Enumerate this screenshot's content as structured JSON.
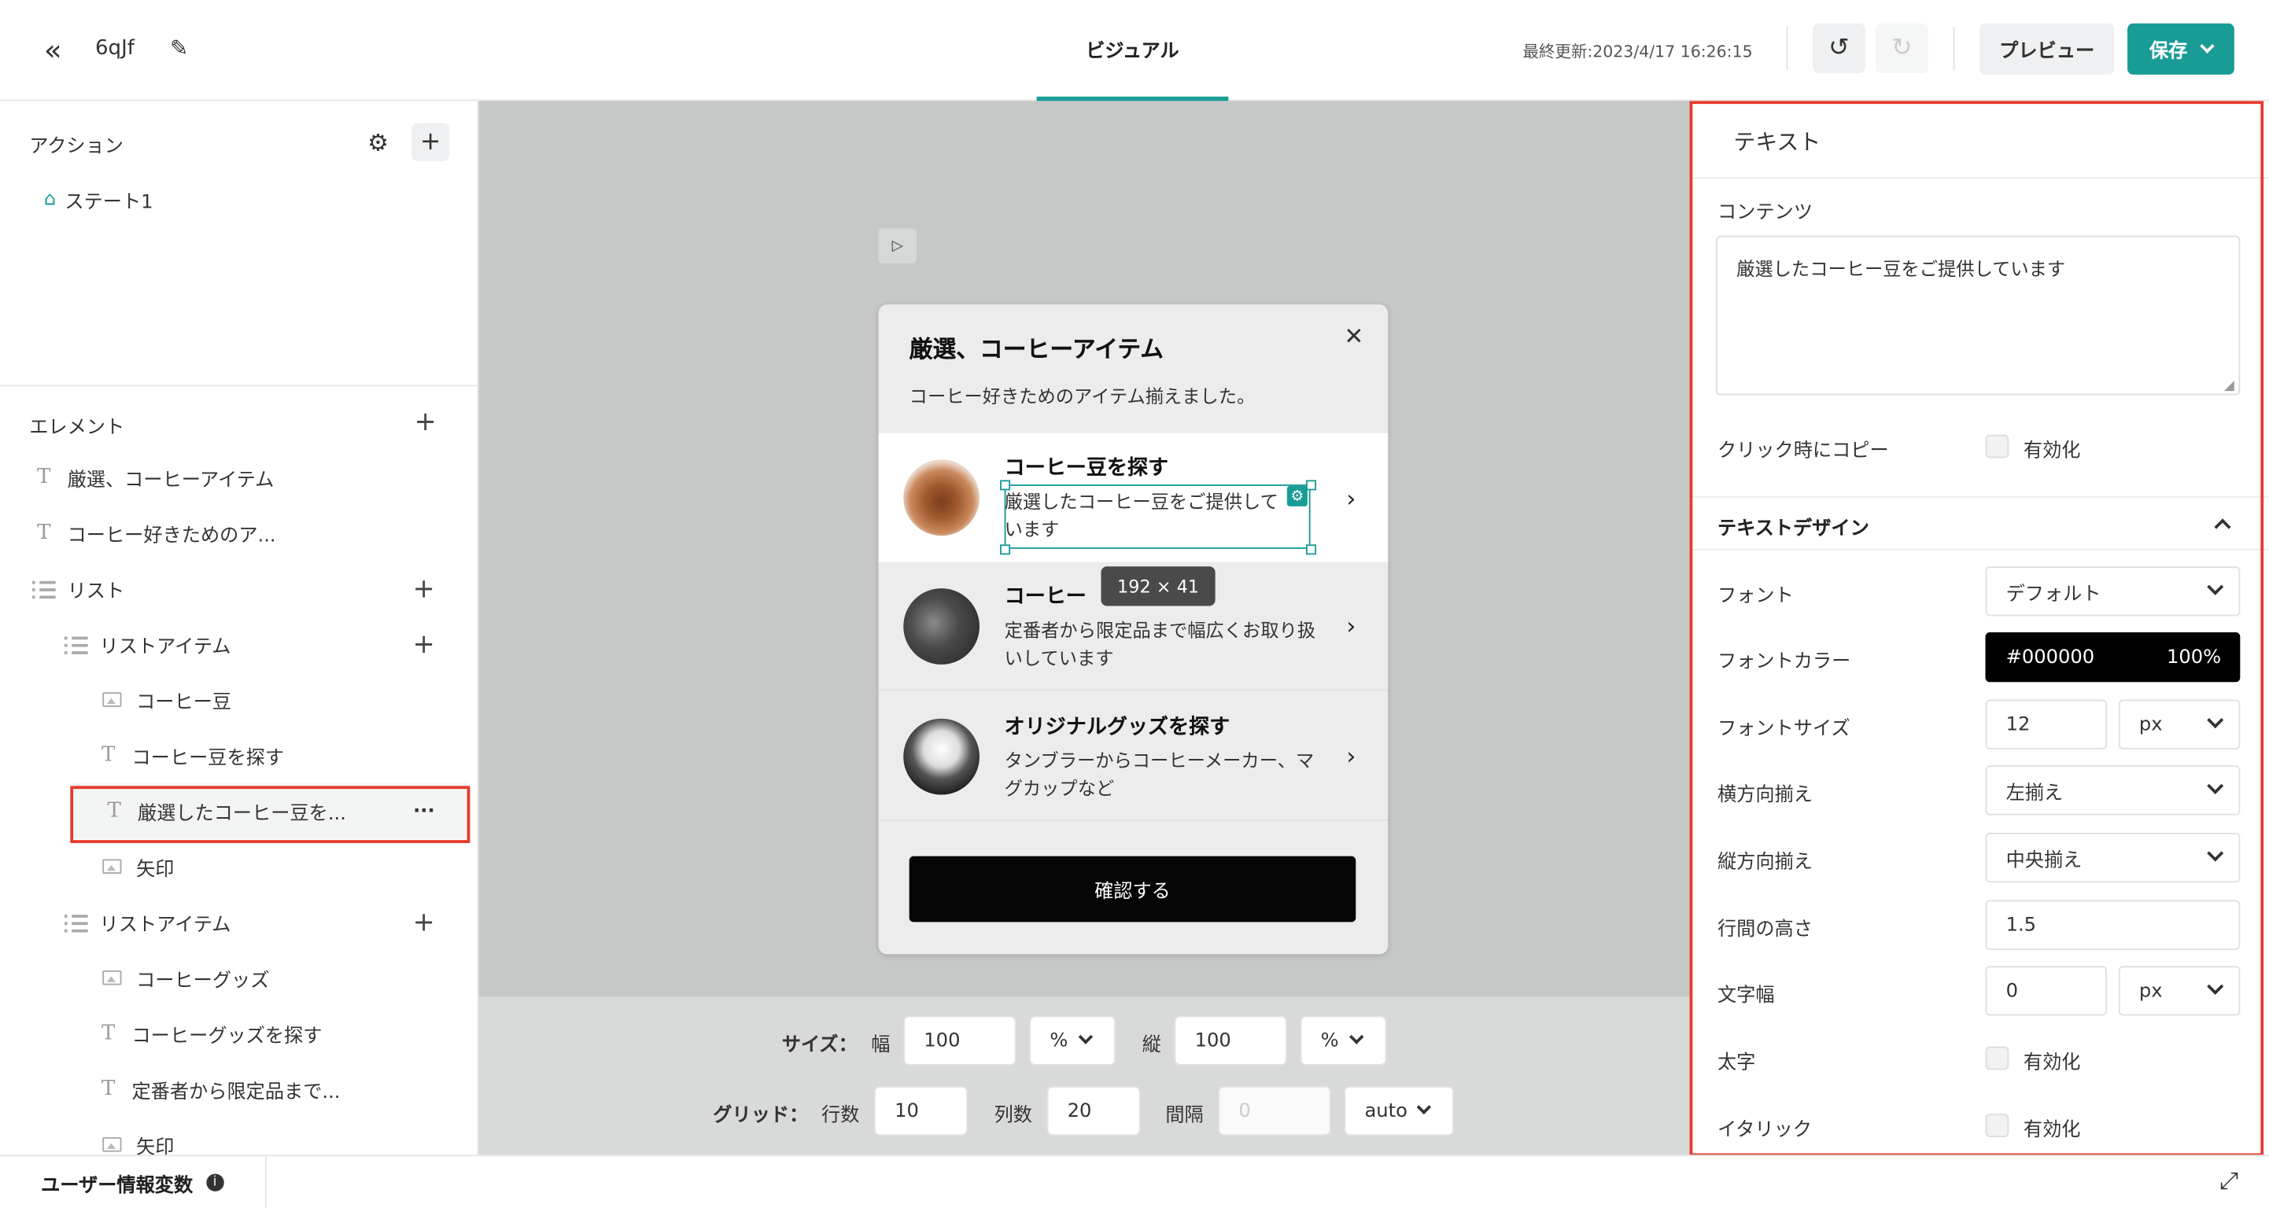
{
  "header": {
    "project_name": "6qJf",
    "center_tab": "ビジュアル",
    "last_updated": "最終更新:2023/4/17 16:26:15",
    "preview_label": "プレビュー",
    "save_label": "保存"
  },
  "sidebar": {
    "actions_title": "アクション",
    "state_label": "ステート1",
    "elements_title": "エレメント",
    "elements": [
      {
        "label": "厳選、コーヒーアイテム",
        "kind": "text"
      },
      {
        "label": "コーヒー好きためのア...",
        "kind": "text"
      },
      {
        "label": "リスト",
        "kind": "list"
      },
      {
        "label": "リストアイテム",
        "kind": "list"
      },
      {
        "label": "コーヒー豆",
        "kind": "image"
      },
      {
        "label": "コーヒー豆を探す",
        "kind": "text"
      },
      {
        "label": "厳選したコーヒー豆を...",
        "kind": "text",
        "selected": true
      },
      {
        "label": "矢印",
        "kind": "image"
      },
      {
        "label": "リストアイテム",
        "kind": "list"
      },
      {
        "label": "コーヒーグッズ",
        "kind": "image"
      },
      {
        "label": "コーヒーグッズを探す",
        "kind": "text"
      },
      {
        "label": "定番者から限定品まで...",
        "kind": "text"
      },
      {
        "label": "矢印",
        "kind": "image"
      }
    ]
  },
  "modal": {
    "title": "厳選、コーヒーアイテム",
    "subtitle": "コーヒー好きためのアイテム揃えました。",
    "items": [
      {
        "title": "コーヒー豆を探す",
        "desc": "厳選したコーヒー豆をご提供しています"
      },
      {
        "title": "コーヒー",
        "desc": "定番者から限定品まで幅広くお取り扱いしています"
      },
      {
        "title": "オリジナルグッズを探す",
        "desc": "タンブラーからコーヒーメーカー、マグカップなど"
      }
    ],
    "confirm_label": "確認する",
    "size_tooltip": "192 × 41"
  },
  "canvas_controls": {
    "size_label": "サイズ：",
    "width_label": "幅",
    "width_value": "100",
    "width_unit": "%",
    "height_label": "縦",
    "height_value": "100",
    "height_unit": "%",
    "grid_label": "グリッド：",
    "rows_label": "行数",
    "rows_value": "10",
    "cols_label": "列数",
    "cols_value": "20",
    "gap_label": "間隔",
    "gap_placeholder": "0",
    "gap_mode": "auto"
  },
  "properties": {
    "panel_title": "テキスト",
    "content_label": "コンテンツ",
    "content_value": "厳選したコーヒー豆をご提供しています",
    "copy_label": "クリック時にコピー",
    "enable_label": "有効化",
    "design_title": "テキストデザイン",
    "font_label": "フォント",
    "font_value": "デフォルト",
    "font_color_label": "フォントカラー",
    "font_color_value": "#000000",
    "font_color_opacity": "100%",
    "font_size_label": "フォントサイズ",
    "font_size_value": "12",
    "font_size_unit": "px",
    "halign_label": "横方向揃え",
    "halign_value": "左揃え",
    "valign_label": "縦方向揃え",
    "valign_value": "中央揃え",
    "line_height_label": "行間の高さ",
    "line_height_value": "1.5",
    "letter_spacing_label": "文字幅",
    "letter_spacing_value": "0",
    "letter_spacing_unit": "px",
    "bold_label": "太字",
    "italic_label": "イタリック"
  },
  "footer": {
    "user_vars_label": "ユーザー情報変数"
  },
  "colors": {
    "accent": "#1a9c96",
    "highlight": "#e8392b",
    "canvas_bg": "#c5c8c7"
  }
}
